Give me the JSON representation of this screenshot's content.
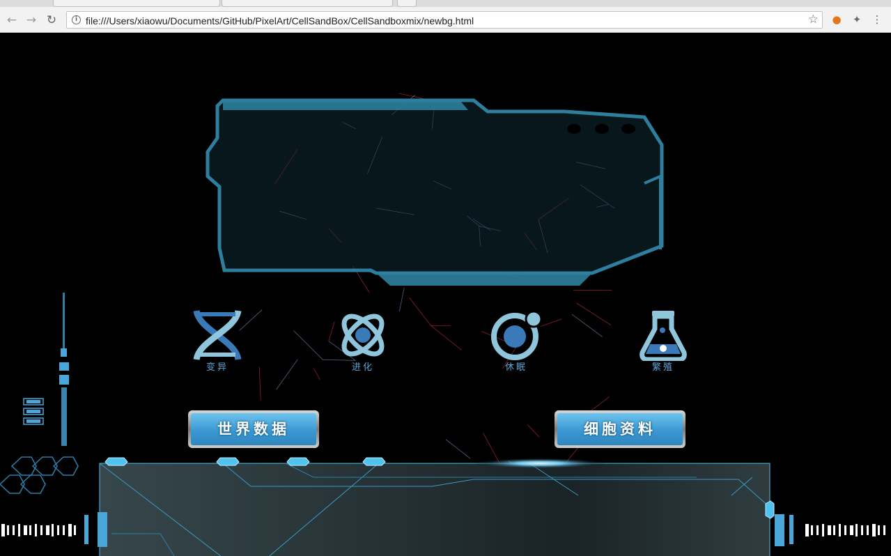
{
  "browser": {
    "url": "file:///Users/xiaowu/Documents/GitHub/PixelArt/CellSandBox/CellSandboxmix/newbg.html",
    "icons": {
      "back": "back-arrow-icon",
      "forward": "forward-arrow-icon",
      "reload": "reload-icon",
      "info": "info-icon",
      "bookmark": "star-icon",
      "extension_1": "fox-extension-icon",
      "extension_2": "sparkle-extension-icon",
      "menu": "kebab-menu-icon"
    }
  },
  "game": {
    "skills": [
      {
        "label": "变异",
        "icon": "dna-icon"
      },
      {
        "label": "进化",
        "icon": "atom-icon"
      },
      {
        "label": "休眠",
        "icon": "orb-icon"
      },
      {
        "label": "繁殖",
        "icon": "flask-icon"
      }
    ],
    "buttons": {
      "world_data": "世界数据",
      "cell_info": "细胞资料"
    },
    "colors": {
      "accent_blue": "#4aa6d8",
      "panel_border": "#2e7f9e",
      "cell_red": "#c0283c",
      "cell_violet": "#7b7fb0"
    }
  }
}
